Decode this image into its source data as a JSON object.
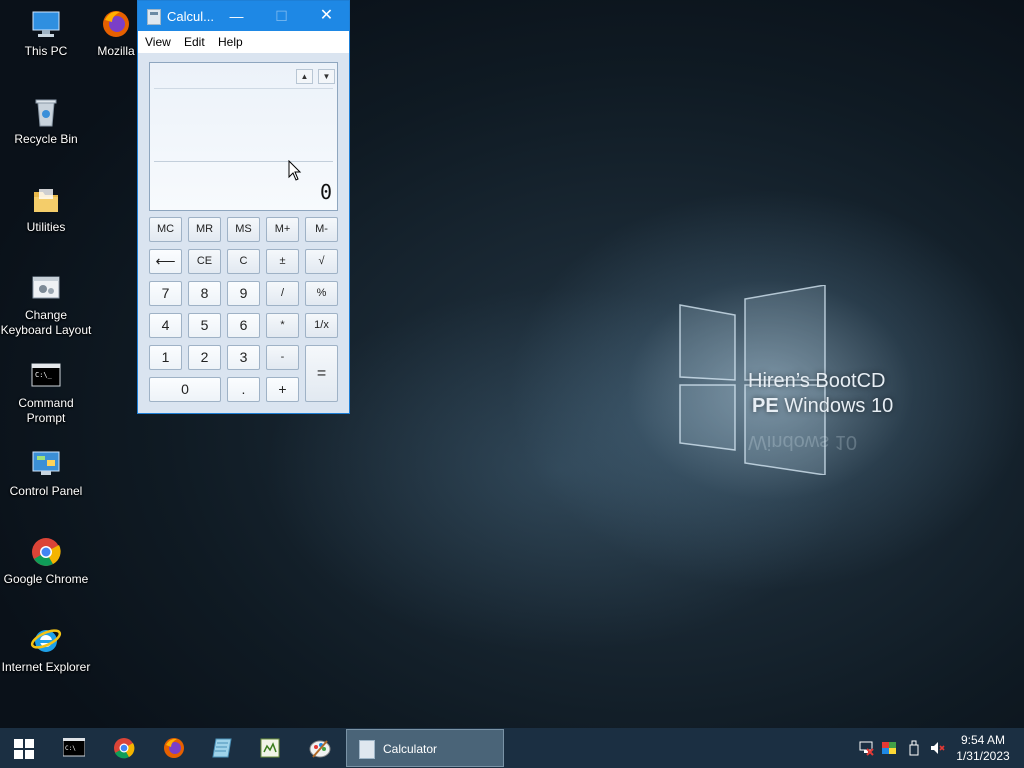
{
  "desktop": {
    "icons": [
      {
        "label": "This PC"
      },
      {
        "label": "Mozilla"
      },
      {
        "label": "Recycle Bin"
      },
      {
        "label": "Utilities"
      },
      {
        "label": "Change Keyboard Layout"
      },
      {
        "label": "Command Prompt"
      },
      {
        "label": "Control Panel"
      },
      {
        "label": "Google Chrome"
      },
      {
        "label": "Internet Explorer"
      }
    ],
    "wallpaper": {
      "brand_line1": "Hiren’s BootCD",
      "brand_line2_bold": "PE",
      "brand_line2": "Windows 10",
      "reflection": "Windows 10"
    }
  },
  "calculator": {
    "title": "Calcul...",
    "menu": [
      "View",
      "Edit",
      "Help"
    ],
    "display_value": "0",
    "scroll_up": "▲",
    "scroll_down": "▼",
    "keys": {
      "mc": "MC",
      "mr": "MR",
      "ms": "MS",
      "mplus": "M+",
      "mminus": "M-",
      "back": "⟵",
      "ce": "CE",
      "c": "C",
      "plusminus": "±",
      "sqrt": "√",
      "seven": "7",
      "eight": "8",
      "nine": "9",
      "divide": "/",
      "percent": "%",
      "four": "4",
      "five": "5",
      "six": "6",
      "multiply": "*",
      "reciprocal": "1/x",
      "one": "1",
      "two": "2",
      "three": "3",
      "minus": "-",
      "equals": "=",
      "zero": "0",
      "decimal": ".",
      "plus": "+"
    },
    "minimize": "—",
    "maximize": "☐",
    "close": "✕"
  },
  "taskbar": {
    "active_window": "Calculator",
    "time": "9:54 AM",
    "date": "1/31/2023"
  },
  "colors": {
    "accent": "#1e88e5",
    "taskbar": "#1b2f42"
  }
}
